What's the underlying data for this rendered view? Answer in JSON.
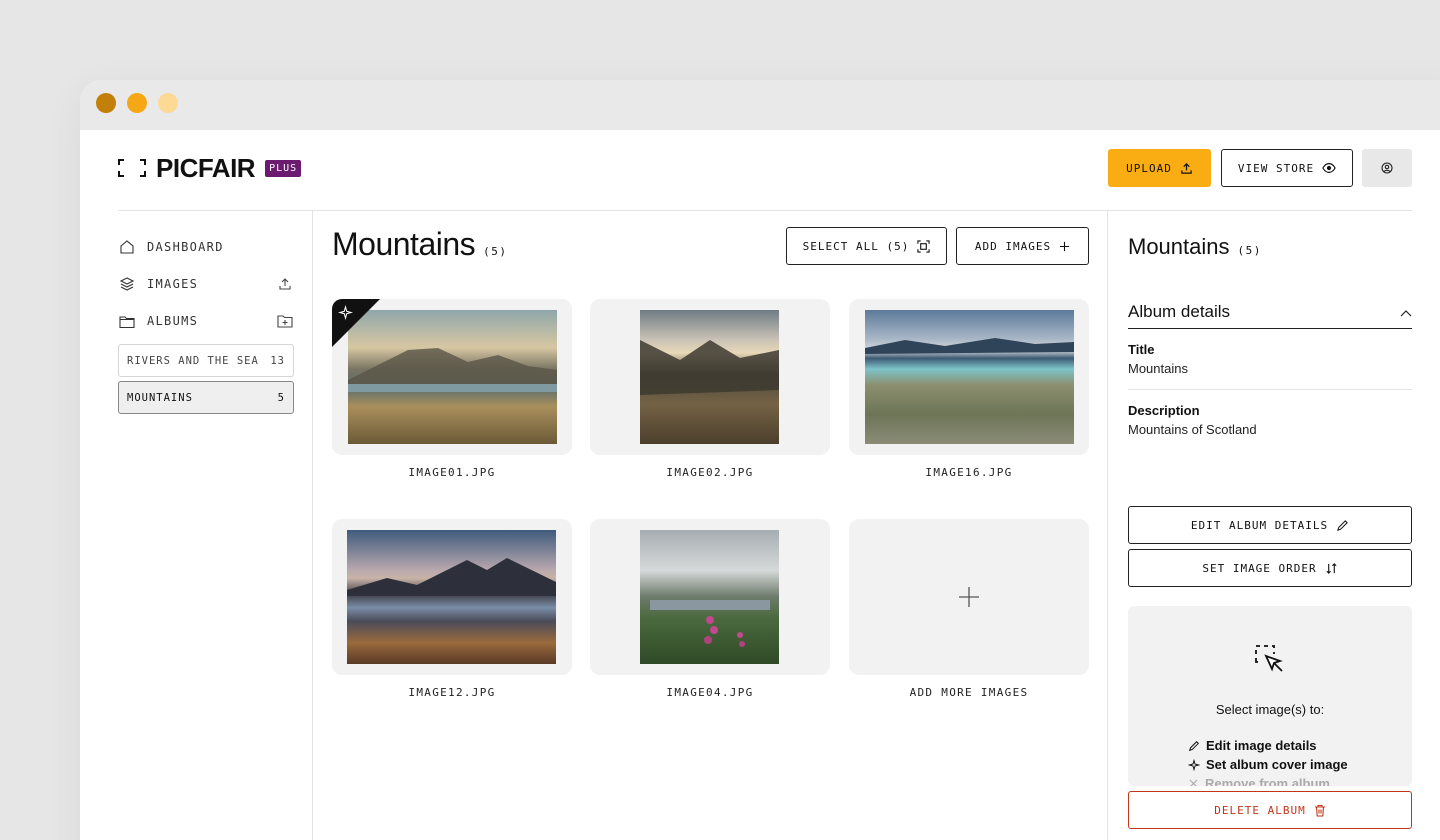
{
  "brand": {
    "name": "PICFAIR",
    "badge": "PLUS"
  },
  "header": {
    "upload_label": "UPLOAD",
    "view_store_label": "VIEW STORE"
  },
  "sidebar": {
    "nav": [
      {
        "label": "DASHBOARD",
        "icon": "home-icon"
      },
      {
        "label": "IMAGES",
        "icon": "layers-icon",
        "action_icon": "upload-icon"
      },
      {
        "label": "ALBUMS",
        "icon": "folder-icon",
        "action_icon": "folder-add-icon"
      }
    ],
    "albums": [
      {
        "name": "RIVERS AND THE SEA",
        "count": "13",
        "active": false
      },
      {
        "name": "MOUNTAINS",
        "count": "5",
        "active": true
      }
    ]
  },
  "main": {
    "title": "Mountains",
    "count": "(5)",
    "select_all_label": "SELECT ALL (5)",
    "add_images_label": "ADD IMAGES",
    "images": [
      {
        "filename": "IMAGE01.JPG",
        "cover": true
      },
      {
        "filename": "IMAGE02.JPG",
        "cover": false
      },
      {
        "filename": "IMAGE16.JPG",
        "cover": false
      },
      {
        "filename": "IMAGE12.JPG",
        "cover": false
      },
      {
        "filename": "IMAGE04.JPG",
        "cover": false
      }
    ],
    "add_more_label": "ADD MORE IMAGES"
  },
  "panel": {
    "title": "Mountains",
    "count": "(5)",
    "section_label": "Album details",
    "title_label": "Title",
    "title_value": "Mountains",
    "description_label": "Description",
    "description_value": "Mountains of Scotland",
    "edit_album_label": "EDIT ALBUM DETAILS",
    "set_order_label": "SET IMAGE ORDER",
    "select_prompt": "Select image(s) to:",
    "options": [
      "Edit image details",
      "Set album cover image",
      "Remove from album"
    ],
    "delete_label": "DELETE ALBUM"
  },
  "colors": {
    "accent": "#f9ad12",
    "badge": "#6a1a6f",
    "danger": "#c0361b"
  }
}
